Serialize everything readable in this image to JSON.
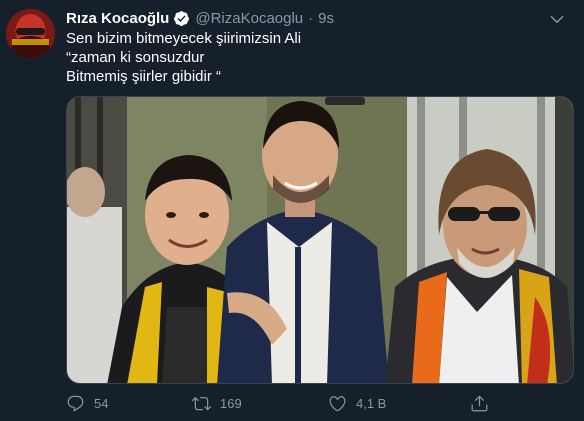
{
  "tweet": {
    "author_name": "Rıza Kocaoğlu",
    "author_handle": "@RizaKocaoglu",
    "separator": "·",
    "time": "9s",
    "verified": true,
    "text_lines": [
      "Sen bizim bitmeyecek şiirimizsin Ali",
      "“zaman ki sonsuzdur",
      "Bitmemiş şiirler gibidir “"
    ],
    "counts": {
      "replies": "54",
      "retweets": "169",
      "likes": "4,1 B"
    }
  },
  "colors": {
    "background": "#15202b",
    "secondary_text": "#8899a6",
    "verified_badge": "#ffffff",
    "border": "#38444d"
  },
  "icons": {
    "reply": "reply-icon",
    "retweet": "retweet-icon",
    "like": "heart-icon",
    "share": "share-icon",
    "more": "chevron-down-icon",
    "verified": "verified-badge-icon"
  }
}
